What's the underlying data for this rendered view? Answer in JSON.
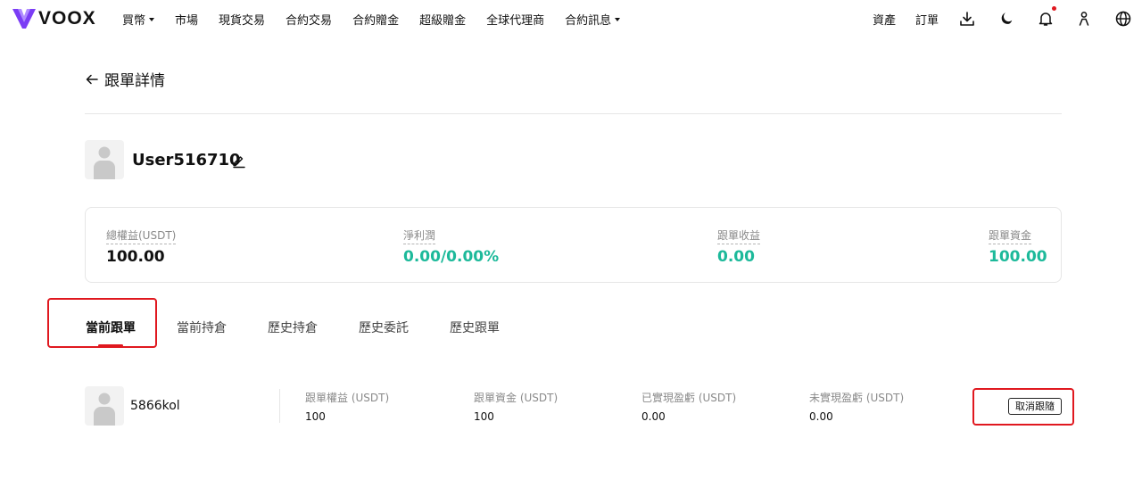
{
  "brand": {
    "name": "VOOX"
  },
  "nav": {
    "menu": [
      {
        "label": "買幣",
        "dropdown": true
      },
      {
        "label": "市場",
        "dropdown": false
      },
      {
        "label": "現貨交易",
        "dropdown": false
      },
      {
        "label": "合約交易",
        "dropdown": false
      },
      {
        "label": "合約贈金",
        "dropdown": false
      },
      {
        "label": "超級贈金",
        "dropdown": false
      },
      {
        "label": "全球代理商",
        "dropdown": false
      },
      {
        "label": "合約訊息",
        "dropdown": true
      }
    ],
    "assets_label": "資產",
    "orders_label": "訂單",
    "icons": [
      "download-icon",
      "moon-icon",
      "bell-icon",
      "user-icon",
      "globe-icon"
    ]
  },
  "page": {
    "title": "跟單詳情"
  },
  "profile": {
    "username": "User516710"
  },
  "stats": [
    {
      "label": "總權益(USDT)",
      "value": "100.00",
      "color": "#111111"
    },
    {
      "label": "淨利潤",
      "value": "0.00/0.00%",
      "color": "#1cb99a"
    },
    {
      "label": "跟單收益",
      "value": "0.00",
      "color": "#1cb99a"
    },
    {
      "label": "跟單資金",
      "value": "100.00",
      "color": "#1cb99a"
    }
  ],
  "tabs": [
    {
      "label": "當前跟單",
      "active": true
    },
    {
      "label": "當前持倉",
      "active": false
    },
    {
      "label": "歷史持倉",
      "active": false
    },
    {
      "label": "歷史委託",
      "active": false
    },
    {
      "label": "歷史跟單",
      "active": false
    }
  ],
  "follow_row": {
    "trader": "5866kol",
    "columns": [
      {
        "label": "跟單權益 (USDT)",
        "value": "100"
      },
      {
        "label": "跟單資金 (USDT)",
        "value": "100"
      },
      {
        "label": "已實現盈虧 (USDT)",
        "value": "0.00"
      },
      {
        "label": "未實現盈虧 (USDT)",
        "value": "0.00"
      }
    ],
    "cancel_label": "取消跟隨"
  },
  "colors": {
    "accent_red": "#e0181f",
    "brand_purple": "#7b3df5",
    "positive_green": "#1cb99a"
  }
}
